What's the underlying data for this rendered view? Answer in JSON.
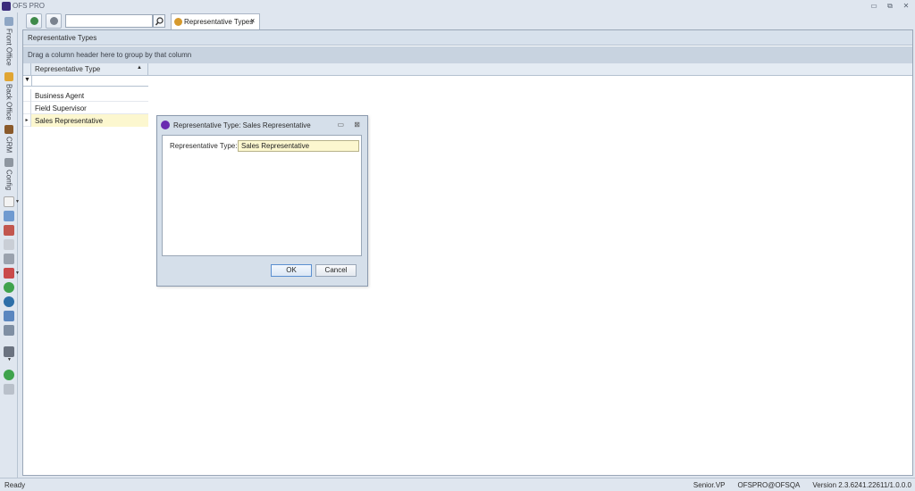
{
  "window": {
    "title": "OFS PRO"
  },
  "sidebar": {
    "tabs": [
      {
        "label": "Front Office",
        "icon": "front-office-icon"
      },
      {
        "label": "Back Office",
        "icon": "back-office-icon"
      },
      {
        "label": "CRM",
        "icon": "crm-icon"
      },
      {
        "label": "Config",
        "icon": "config-icon"
      }
    ]
  },
  "toolbar": {
    "search": {
      "value": "",
      "placeholder": ""
    },
    "tab": {
      "label": "Representative Types",
      "close": "×"
    }
  },
  "grid": {
    "caption": "Representative Types",
    "group_hint": "Drag a column header here to group by that column",
    "column": "Representative Type",
    "sort_icon": "▲",
    "filter_icon": "▼",
    "row_indicator": "▸",
    "rows": [
      "Business Agent",
      "Field Supervisor",
      "Sales Representative"
    ]
  },
  "dialog": {
    "title": "Representative Type: Sales Representative",
    "field_label": "Representative Type:",
    "field_value": "Sales Representative",
    "ok_label": "OK",
    "cancel_label": "Cancel"
  },
  "status": {
    "ready": "Ready",
    "user": "Senior.VP",
    "connection": "OFSPRO@OFSQA",
    "version": "Version 2.3.6241.22611/1.0.0.0"
  }
}
